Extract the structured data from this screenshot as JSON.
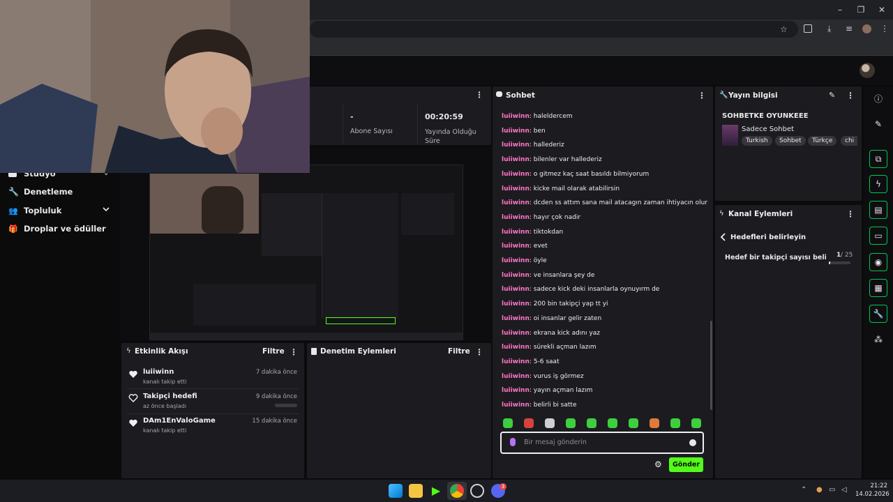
{
  "colors": {
    "accent_green": "#53fc18",
    "username_pink": "#ff75c6",
    "panel_bg": "#1c1c20",
    "page_bg": "#0b0b0c"
  },
  "nav": {
    "items": [
      {
        "label": "Stüdyo",
        "icon": "video-icon"
      },
      {
        "label": "Denetleme",
        "icon": "wrench-icon"
      },
      {
        "label": "Topluluk",
        "icon": "users-icon"
      },
      {
        "label": "Droplar ve ödüller",
        "icon": "gift-icon"
      }
    ]
  },
  "stats": {
    "subscribers_value": "-",
    "subscribers_label": "Abone Sayısı",
    "live_value": "00:20:59",
    "live_label": "Yayında Olduğu Süre"
  },
  "activity": {
    "title": "Etkinlik Akışı",
    "filter": "Filtre",
    "items": [
      {
        "name": "luiiwinn",
        "sub": "kanalı takip etti",
        "time": "7 dakika önce",
        "icon": "heart-icon"
      },
      {
        "name": "Takipçi hedefi",
        "sub": "az önce başladı",
        "time": "9 dakika önce",
        "icon": "heart-outline-icon"
      },
      {
        "name": "DAm1EnValoGame",
        "sub": "kanalı takip etti",
        "time": "15 dakika önce",
        "icon": "heart-icon"
      }
    ]
  },
  "moderation": {
    "title": "Denetim Eylemleri",
    "filter": "Filtre"
  },
  "chat": {
    "title": "Sohbet",
    "messages": [
      {
        "user": "luiiwinn",
        "text": "haleldercem"
      },
      {
        "user": "luiiwinn",
        "text": "ben"
      },
      {
        "user": "luiiwinn",
        "text": "hallederiz"
      },
      {
        "user": "luiiwinn",
        "text": "bilenler var hallederiz"
      },
      {
        "user": "luiiwinn",
        "text": "o gitmez kaç saat basıldı bilmiyorum"
      },
      {
        "user": "luiiwinn",
        "text": "kicke mail olarak atabilirsin"
      },
      {
        "user": "luiiwinn",
        "text": "dcden ss attım sana mail atacagın zaman ihtiyacın olur"
      },
      {
        "user": "luiiwinn",
        "text": "hayır çok nadir"
      },
      {
        "user": "luiiwinn",
        "text": "tiktokdan"
      },
      {
        "user": "luiiwinn",
        "text": "evet"
      },
      {
        "user": "luiiwinn",
        "text": "öyle"
      },
      {
        "user": "luiiwinn",
        "text": "ve insanlara şey de"
      },
      {
        "user": "luiiwinn",
        "text": "sadece kick deki insanlarla oynuyırm de"
      },
      {
        "user": "luiiwinn",
        "text": "200 bin takipçi yap tt yi"
      },
      {
        "user": "luiiwinn",
        "text": "oi insanlar gelir zaten"
      },
      {
        "user": "luiiwinn",
        "text": "ekrana kick adını yaz"
      },
      {
        "user": "luiiwinn",
        "text": "sürekli açman lazım"
      },
      {
        "user": "luiiwinn",
        "text": "5-6 saat"
      },
      {
        "user": "luiiwinn",
        "text": "vurus iş görmez"
      },
      {
        "user": "luiiwinn",
        "text": "yayın açman lazım"
      },
      {
        "user": "luiiwinn",
        "text": "belirli bi satte"
      }
    ],
    "input_placeholder": "Bir mesaj gönderin",
    "send_label": "Gönder"
  },
  "stream_info": {
    "title": "Yayın bilgisi",
    "stream_title": "SOHBETKE OYUNKEEE",
    "category": "Sadece Sohbet",
    "tags": [
      "Turkish",
      "Sohbet",
      "Türkçe",
      "chi"
    ]
  },
  "channel_actions": {
    "title": "Kanal Eylemleri",
    "back_label": "Hedefleri belirleyin",
    "goal_label": "Hedef bir takipçi sayısı belirle...",
    "goal_current": "1",
    "goal_total": "/ 25",
    "goal_progress": 0.04
  },
  "taskbar": {
    "time": "21:22",
    "date": "14.02.2026",
    "discord_badge": "3"
  }
}
